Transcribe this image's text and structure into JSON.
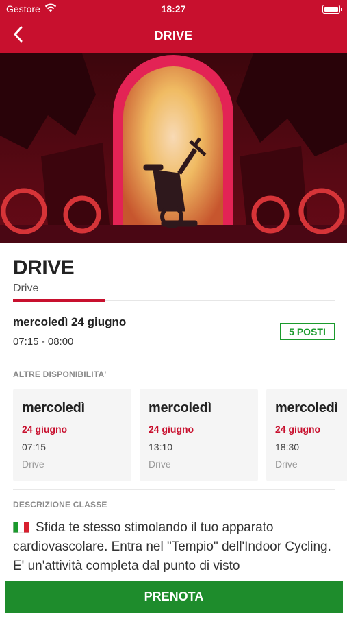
{
  "status_bar": {
    "carrier": "Gestore",
    "time": "18:27"
  },
  "nav": {
    "title": "DRIVE",
    "back_icon": "chevron-left-icon"
  },
  "hero": {
    "image": "indoor-cycling-studio-photo"
  },
  "class_info": {
    "title": "DRIVE",
    "subtitle": "Drive",
    "date": "mercoledì 24 giugno",
    "time": "07:15 - 08:00",
    "seats": "5 POSTI"
  },
  "other_availability": {
    "label": "ALTRE DISPONIBILITA'",
    "cards": [
      {
        "day": "mercoledì",
        "date": "24 giugno",
        "time": "07:15",
        "name": "Drive"
      },
      {
        "day": "mercoledì",
        "date": "24 giugno",
        "time": "13:10",
        "name": "Drive"
      },
      {
        "day": "mercoledì",
        "date": "24 giugno",
        "time": "18:30",
        "name": "Drive"
      }
    ]
  },
  "description": {
    "label": "DESCRIZIONE CLASSE",
    "flag_icon": "italy-flag-icon",
    "text": "Sfida te stesso stimolando il tuo apparato cardiovascolare. Entra nel \"Tempio\" dell'Indoor Cycling. E' un'attività completa dal punto di visto"
  },
  "cta": {
    "label": "PRENOTA"
  },
  "colors": {
    "brand_red": "#c8102e",
    "success_green": "#1e8c2c",
    "seats_green": "#1a9a2c"
  }
}
